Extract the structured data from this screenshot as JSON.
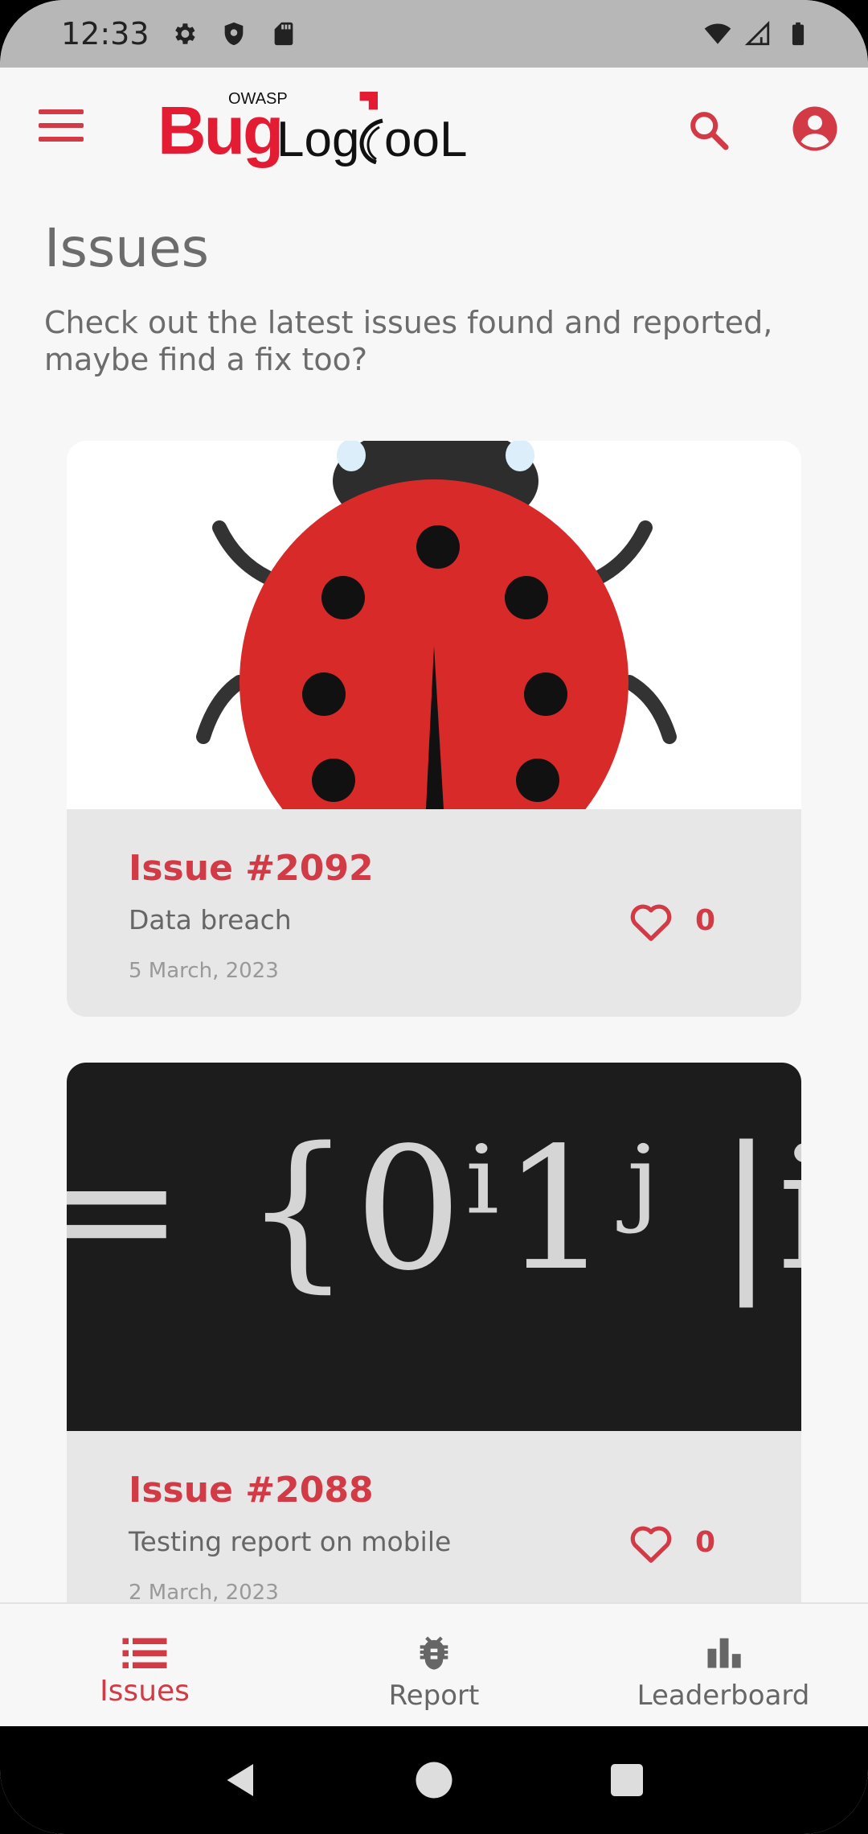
{
  "status_bar": {
    "time": "12:33",
    "icons_left": [
      "gear-icon",
      "shield-icon",
      "sd-card-icon"
    ],
    "icons_right": [
      "wifi-icon",
      "signal-icon",
      "battery-icon"
    ]
  },
  "app_bar": {
    "logo_main": "Bug",
    "logo_owasp": "OWASP",
    "logo_log": "Log",
    "logo_tool": "ooL",
    "menu_icon": "hamburger-menu-icon",
    "search_icon": "search-icon",
    "account_icon": "account-circle-icon"
  },
  "page": {
    "title": "Issues",
    "subtitle": "Check out the latest issues found and reported, maybe find a fix too?"
  },
  "issues": [
    {
      "title": "Issue #2092",
      "description": "Data breach",
      "date": "5 March, 2023",
      "likes": "0",
      "image": "ladybug"
    },
    {
      "title": "Issue #2088",
      "description": "Testing report on mobile",
      "date": "2 March, 2023",
      "likes": "0",
      "image_text": "= {0ⁱ1ʲ |i"
    }
  ],
  "bottom_nav": {
    "items": [
      {
        "label": "Issues",
        "icon": "list-icon",
        "active": true
      },
      {
        "label": "Report",
        "icon": "bug-icon",
        "active": false
      },
      {
        "label": "Leaderboard",
        "icon": "bar-chart-icon",
        "active": false
      }
    ]
  },
  "colors": {
    "accent": "#d23a46",
    "status_bar": "#b7b7b7",
    "background": "#f7f7f7",
    "card": "#e7e7e7"
  }
}
